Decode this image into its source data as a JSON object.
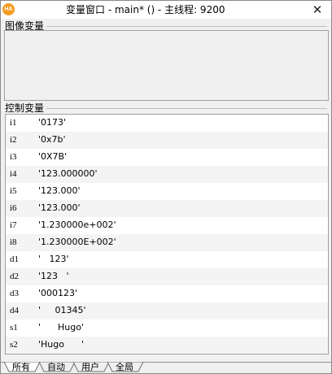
{
  "window": {
    "icon_label": "HA",
    "title": "变量窗口 - main* () - 主线程: 9200",
    "close_glyph": "✕"
  },
  "image_group": {
    "label": "图像变量"
  },
  "control_group": {
    "label": "控制变量"
  },
  "variables": [
    {
      "name": "i1",
      "value": "'0173'"
    },
    {
      "name": "i2",
      "value": "'0x7b'"
    },
    {
      "name": "i3",
      "value": "'0X7B'"
    },
    {
      "name": "i4",
      "value": "'123.000000'"
    },
    {
      "name": "i5",
      "value": "'123.000'"
    },
    {
      "name": "i6",
      "value": "'123.000'"
    },
    {
      "name": "i7",
      "value": "'1.230000e+002'"
    },
    {
      "name": "i8",
      "value": "'1.230000E+002'"
    },
    {
      "name": "d1",
      "value": "'   123'"
    },
    {
      "name": "d2",
      "value": "'123   '"
    },
    {
      "name": "d3",
      "value": "'000123'"
    },
    {
      "name": "d4",
      "value": "'     01345'"
    },
    {
      "name": "s1",
      "value": "'      Hugo'"
    },
    {
      "name": "s2",
      "value": "'Hugo      '"
    }
  ],
  "tabs": [
    {
      "label": "所有",
      "active": true
    },
    {
      "label": "自动",
      "active": false
    },
    {
      "label": "用户",
      "active": false
    },
    {
      "label": "全局",
      "active": false
    }
  ]
}
